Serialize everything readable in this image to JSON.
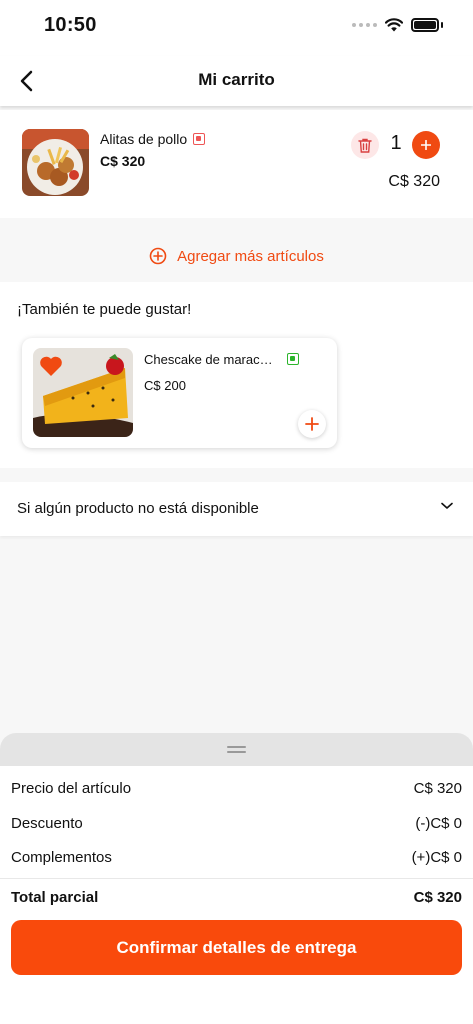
{
  "status": {
    "time": "10:50"
  },
  "header": {
    "title": "Mi carrito"
  },
  "cart": {
    "items": [
      {
        "name": "Alitas de pollo",
        "price": "C$ 320",
        "quantity": "1",
        "total": "C$ 320",
        "diet_mark_color": "#e55"
      }
    ]
  },
  "add_more": {
    "label": "Agregar más artículos"
  },
  "suggestions": {
    "title": "¡También te puede gustar!",
    "items": [
      {
        "name": "Chescake de maracuyá",
        "price": "C$ 200",
        "diet_mark_color": "#2cb52c"
      }
    ]
  },
  "unavailable": {
    "label": "Si algún producto no está disponible"
  },
  "summary": {
    "rows": [
      {
        "label": "Precio del artículo",
        "value": "C$ 320"
      },
      {
        "label": "Descuento",
        "value": "(-)C$ 0"
      },
      {
        "label": "Complementos",
        "value": "(+)C$ 0"
      }
    ],
    "total": {
      "label": "Total parcial",
      "value": "C$ 320"
    },
    "confirm_label": "Confirmar detalles de entrega"
  },
  "colors": {
    "accent": "#f04a12",
    "button": "#f94a0c"
  },
  "icons": {
    "back": "back-arrow-icon",
    "trash": "trash-icon",
    "plus": "plus-icon",
    "add_circle": "plus-circle-icon",
    "heart": "heart-icon",
    "chevron": "chevron-down-icon"
  }
}
